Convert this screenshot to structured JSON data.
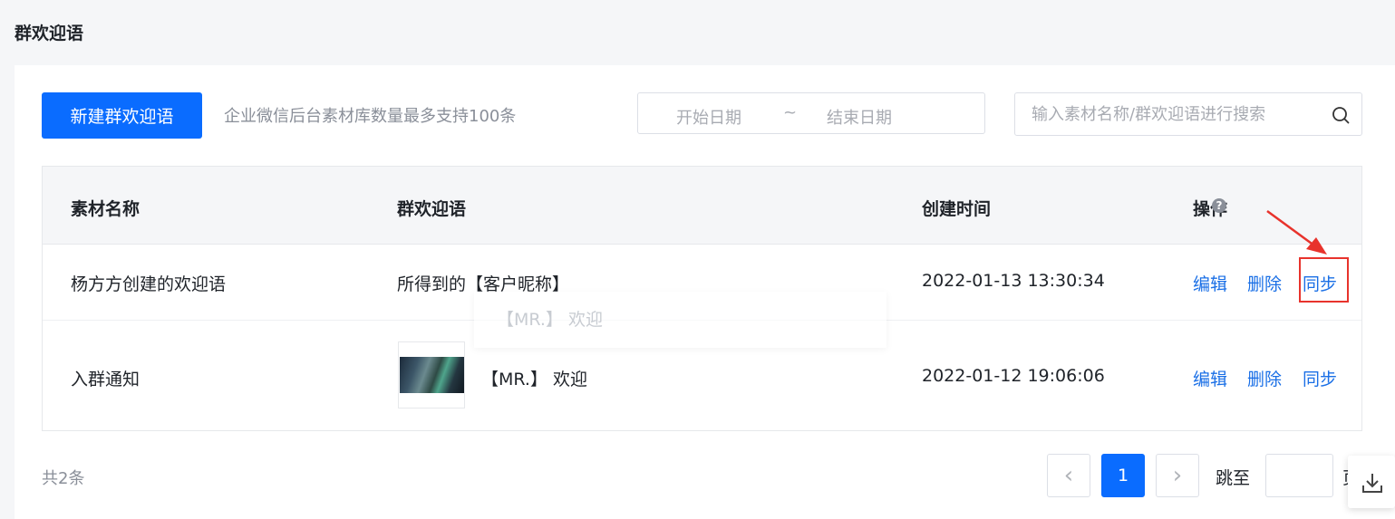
{
  "page": {
    "title": "群欢迎语"
  },
  "toolbar": {
    "new_button_label": "新建群欢迎语",
    "hint": "企业微信后台素材库数量最多支持100条",
    "date_start_placeholder": "开始日期",
    "date_separator": "~",
    "date_end_placeholder": "结束日期",
    "search_placeholder": "输入素材名称/群欢迎语进行搜索"
  },
  "table": {
    "columns": [
      "素材名称",
      "群欢迎语",
      "创建时间",
      "操作"
    ],
    "help_glyph": "?",
    "rows": [
      {
        "name": "杨方方创建的欢迎语",
        "welcome": "所得到的【客户昵称】",
        "created": "2022-01-13 13:30:34",
        "actions": [
          "编辑",
          "删除",
          "同步"
        ]
      },
      {
        "name": "入群通知",
        "welcome": "【MR.】 欢迎",
        "created": "2022-01-12 19:06:06",
        "actions": [
          "编辑",
          "删除",
          "同步"
        ],
        "has_thumbnail": true
      }
    ],
    "hover_preview": "【MR.】 欢迎"
  },
  "pagination": {
    "total_text": "共2条",
    "prev_glyph": "‹",
    "current_page": "1",
    "next_glyph": "›",
    "jump_label": "跳至",
    "suffix": "页"
  },
  "colors": {
    "primary": "#0a6cff",
    "link": "#1a6fe6",
    "annotation": "#e8332c"
  },
  "icons": [
    "search-icon",
    "help-icon",
    "download-icon",
    "chevron-left-icon",
    "chevron-right-icon"
  ]
}
